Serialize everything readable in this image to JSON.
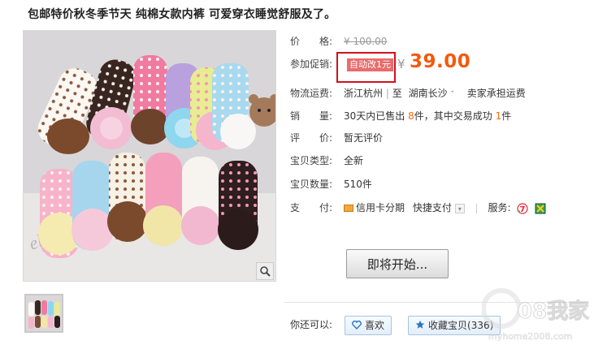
{
  "product": {
    "title": "包邮特价秋冬季节天 纯棉女款内裤 可爱穿衣睡觉舒服及了。"
  },
  "info": {
    "price_label": "价　　格:",
    "original_price": "¥ 100.00",
    "promo_label": "参加促销:",
    "promo_badge": "自动改1元",
    "currency": "¥",
    "promo_price": "39.00",
    "shipping_label": "物流运费:",
    "ship_from": "浙江杭州",
    "ship_to_prefix": "至",
    "ship_to": "湖南长沙",
    "shipping_fee": "卖家承担运费",
    "sales_label": "销　　量:",
    "sales_prefix": "30天内已售出",
    "sales_count": "8",
    "sales_mid": "件，其中交易成功",
    "sales_success": "1",
    "sales_suffix": "件",
    "rating_label": "评　　价:",
    "rating_value": "暂无评价",
    "type_label": "宝贝类型:",
    "type_value": "全新",
    "qty_label": "宝贝数量:",
    "qty_value": "510件",
    "pay_label": "支　　付:",
    "pay_installment": "信用卡分期",
    "pay_quick": "快捷支付",
    "service_label": "服务:"
  },
  "actions": {
    "start_button": "即将开始...",
    "you_can_label": "你还可以:",
    "like_button": "喜欢",
    "favorite_button": "收藏宝贝",
    "favorite_count": "(336)"
  },
  "watermark": {
    "text": "08我家",
    "url": "myhome2008.com"
  },
  "colors": {
    "price_orange": "#f25a0e",
    "promo_border": "#d0101c",
    "promo_badge_bg": "#e96c6c"
  }
}
